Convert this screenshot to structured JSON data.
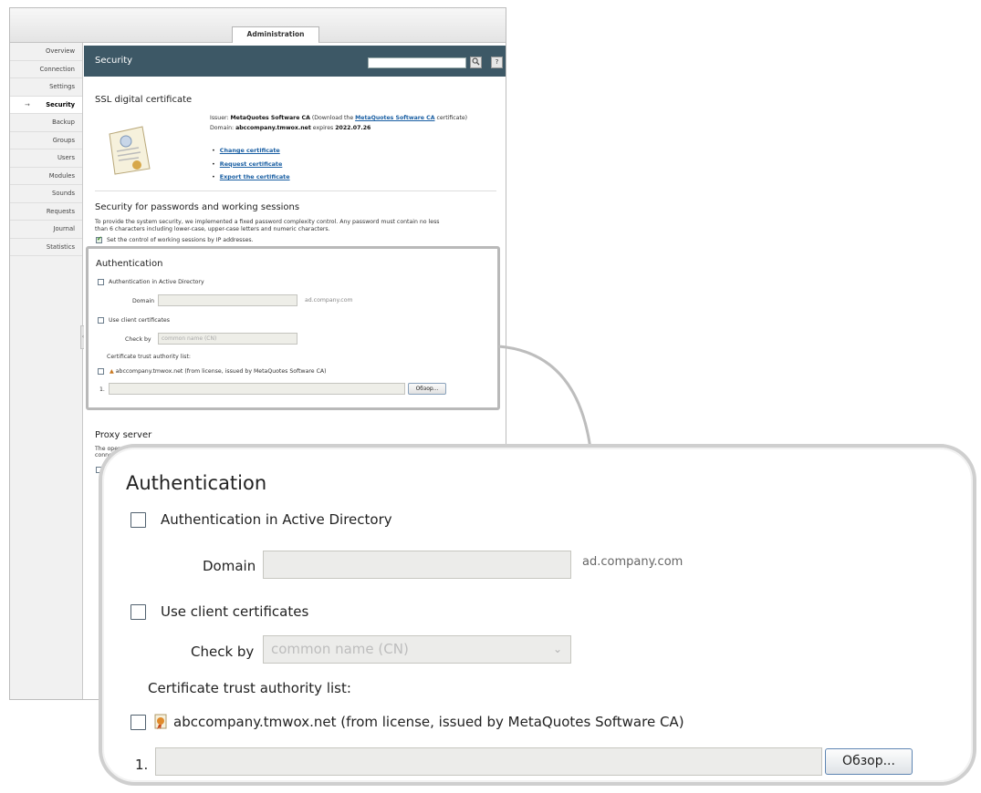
{
  "tabs": {
    "active": "Administration"
  },
  "sidebar": {
    "items": [
      {
        "label": "Overview"
      },
      {
        "label": "Connection"
      },
      {
        "label": "Settings"
      },
      {
        "label": "Security"
      },
      {
        "label": "Backup"
      },
      {
        "label": "Groups"
      },
      {
        "label": "Users"
      },
      {
        "label": "Modules"
      },
      {
        "label": "Sounds"
      },
      {
        "label": "Requests"
      },
      {
        "label": "Journal"
      },
      {
        "label": "Statistics"
      }
    ],
    "active_index": 3
  },
  "header": {
    "title": "Security",
    "search_icon": "search-icon",
    "help_label": "?"
  },
  "ssl": {
    "title": "SSL digital certificate",
    "issuer_prefix": "Issuer:",
    "issuer_name": "MetaQuotes Software CA",
    "issuer_paren_open": "(Download the",
    "issuer_link": "MetaQuotes Software CA",
    "issuer_paren_close": "certificate)",
    "domain_prefix": "Domain:",
    "domain_value": "abccompany.tmwox.net",
    "expires_label": "expires",
    "expires_date": "2022.07.26",
    "links": [
      "Change certificate",
      "Request certificate",
      "Export the certificate"
    ]
  },
  "passwords": {
    "title": "Security for passwords and working sessions",
    "description_1": "To provide the system security, we implemented a fixed password complexity control. Any password must contain no less",
    "description_2": "than 6 characters including lower-case, upper-case letters and numeric characters.",
    "ip_check_label": "Set the control of working sessions by IP addresses.",
    "ip_check_checked": true
  },
  "auth_small": {
    "title": "Authentication",
    "ad_label": "Authentication in Active Directory",
    "domain_label": "Domain",
    "domain_hint": "ad.company.com",
    "client_certs_label": "Use client certificates",
    "check_by_label": "Check by",
    "check_by_value": "common name (CN)",
    "trust_list_label": "Certificate trust authority list:",
    "trust_item": "abccompany.tmwox.net (from license, issued by MetaQuotes Software CA)",
    "row_number": "1.",
    "browse_label": "Обзор..."
  },
  "proxy": {
    "title": "Proxy server",
    "text_1": "The operation",
    "text_2": "connectio"
  },
  "callout": {
    "title": "Authentication",
    "ad_label": "Authentication in Active Directory",
    "ad_checked": false,
    "domain_label": "Domain",
    "domain_value": "",
    "domain_hint": "ad.company.com",
    "client_certs_label": "Use client certificates",
    "client_certs_checked": false,
    "check_by_label": "Check by",
    "check_by_value": "common name (CN)",
    "trust_list_label": "Certificate trust authority list:",
    "trust_item": "abccompany.tmwox.net (from license, issued by MetaQuotes Software CA)",
    "trust_item_checked": false,
    "row_number": "1.",
    "file_value": "",
    "browse_label": "Обзор..."
  },
  "colors": {
    "header_bg": "#3d5866",
    "link": "#1a5fa3",
    "callout_border": "#cfcfcf"
  }
}
